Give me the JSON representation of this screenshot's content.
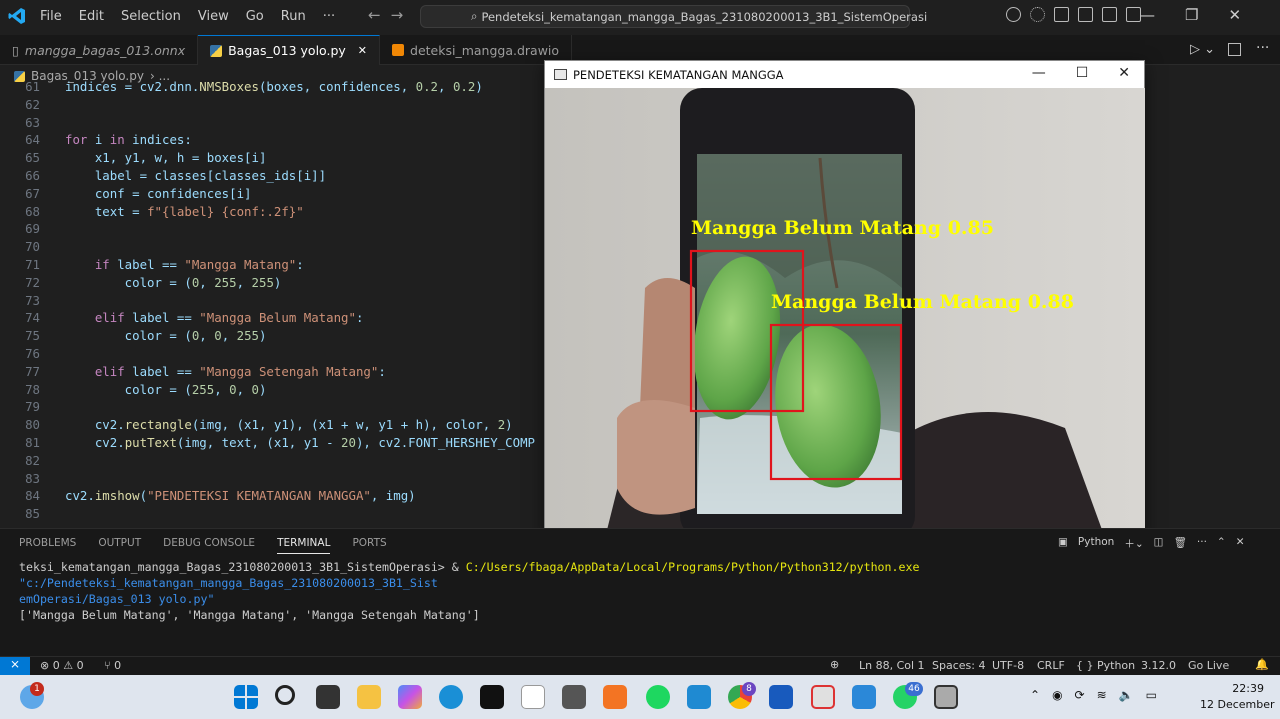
{
  "titlebar": {
    "menu": [
      "File",
      "Edit",
      "Selection",
      "View",
      "Go",
      "Run",
      "···"
    ],
    "search_text": "Pendeteksi_kematangan_mangga_Bagas_231080200013_3B1_SistemOperasi"
  },
  "tabs": [
    {
      "label": "mangga_bagas_013.onnx"
    },
    {
      "label": "Bagas_013 yolo.py",
      "close": "✕"
    },
    {
      "label": "deteksi_mangga.drawio"
    }
  ],
  "breadcrumb": {
    "file": "Bagas_013 yolo.py",
    "sep": "› ..."
  },
  "code_lines": [
    {
      "n": "61",
      "t": "indices = cv2.dnn.NMSBoxes(boxes, confidences, 0.2, 0.2)"
    },
    {
      "n": "62",
      "t": ""
    },
    {
      "n": "63",
      "t": ""
    },
    {
      "n": "64",
      "t": "for i in indices:"
    },
    {
      "n": "65",
      "t": "    x1, y1, w, h = boxes[i]"
    },
    {
      "n": "66",
      "t": "    label = classes[classes_ids[i]]"
    },
    {
      "n": "67",
      "t": "    conf = confidences[i]"
    },
    {
      "n": "68",
      "t": "    text = f\"{label} {conf:.2f}\""
    },
    {
      "n": "69",
      "t": ""
    },
    {
      "n": "70",
      "t": ""
    },
    {
      "n": "71",
      "t": "    if label == \"Mangga Matang\":"
    },
    {
      "n": "72",
      "t": "        color = (0, 255, 255)"
    },
    {
      "n": "73",
      "t": ""
    },
    {
      "n": "74",
      "t": "    elif label == \"Mangga Belum Matang\":"
    },
    {
      "n": "75",
      "t": "        color = (0, 0, 255)"
    },
    {
      "n": "76",
      "t": ""
    },
    {
      "n": "77",
      "t": "    elif label == \"Mangga Setengah Matang\":"
    },
    {
      "n": "78",
      "t": "        color = (255, 0, 0)"
    },
    {
      "n": "79",
      "t": ""
    },
    {
      "n": "80",
      "t": "    cv2.rectangle(img, (x1, y1), (x1 + w, y1 + h), color, 2)"
    },
    {
      "n": "81",
      "t": "    cv2.putText(img, text, (x1, y1 - 20), cv2.FONT_HERSHEY_COMP"
    },
    {
      "n": "82",
      "t": ""
    },
    {
      "n": "83",
      "t": ""
    },
    {
      "n": "84",
      "t": "cv2.imshow(\"PENDETEKSI KEMATANGAN MANGGA\", img)"
    },
    {
      "n": "85",
      "t": ""
    }
  ],
  "cv_window": {
    "title": "PENDETEKSI KEMATANGAN MANGGA",
    "detections": [
      {
        "label": "Mangga Belum Matang 0.85"
      },
      {
        "label": "Mangga Belum Matang 0.88"
      }
    ],
    "box_color": "#e0141c",
    "text_color": "#ffff00"
  },
  "panel": {
    "tabs": [
      "PROBLEMS",
      "OUTPUT",
      "DEBUG CONSOLE",
      "TERMINAL",
      "PORTS"
    ],
    "active_tab": "TERMINAL",
    "shell": "Python",
    "terminal": {
      "prompt": "teksi_kematangan_mangga_Bagas_231080200013_3B1_SistemOperasi> & ",
      "exe": "C:/Users/fbaga/AppData/Local/Programs/Python/Python312/python.exe",
      "arg1": " \"c:/Pendeteksi_kematangan_mangga_Bagas_231080200013_3B1_Sist",
      "arg2": "emOperasi/Bagas_013 yolo.py\"",
      "output": "['Mangga Belum Matang', 'Mangga Matang', 'Mangga Setengah Matang']"
    }
  },
  "statusbar": {
    "errors": "⊗ 0 ⚠ 0",
    "ports": "⑂ 0",
    "position": "Ln 88, Col 1",
    "spaces": "Spaces: 4",
    "encoding": "UTF-8",
    "eol": "CRLF",
    "language": "{ } Python",
    "version": "3.12.0",
    "golive": "Go Live"
  },
  "taskbar": {
    "time": "22:39",
    "date": "12 December",
    "badge_chrome": "8",
    "badge_whatsapp": "46",
    "badge_weather": "1"
  },
  "colors": {
    "accent": "#0078d4",
    "editor_bg": "#1f1f1f",
    "taskbar_bg": "#dfe5ee"
  }
}
